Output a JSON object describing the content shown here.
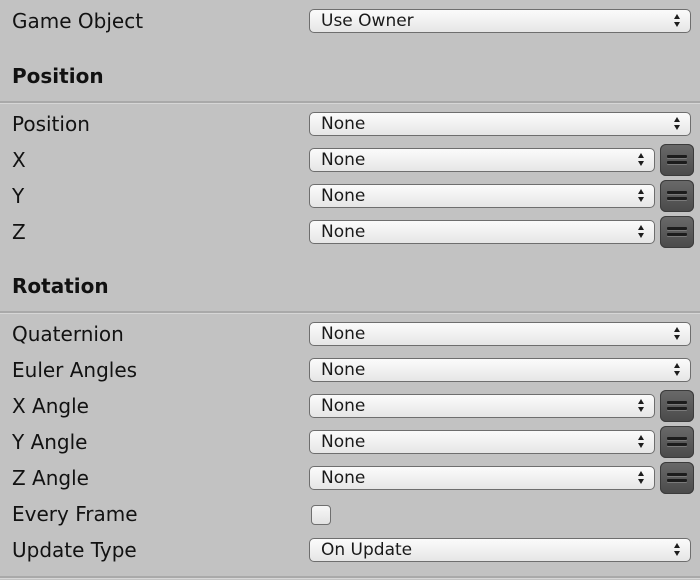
{
  "game_object": {
    "label": "Game Object",
    "value": "Use Owner"
  },
  "position_section": {
    "heading": "Position",
    "position": {
      "label": "Position",
      "value": "None"
    },
    "x": {
      "label": "X",
      "value": "None"
    },
    "y": {
      "label": "Y",
      "value": "None"
    },
    "z": {
      "label": "Z",
      "value": "None"
    }
  },
  "rotation_section": {
    "heading": "Rotation",
    "quaternion": {
      "label": "Quaternion",
      "value": "None"
    },
    "euler_angles": {
      "label": "Euler Angles",
      "value": "None"
    },
    "x_angle": {
      "label": "X Angle",
      "value": "None"
    },
    "y_angle": {
      "label": "Y Angle",
      "value": "None"
    },
    "z_angle": {
      "label": "Z Angle",
      "value": "None"
    }
  },
  "every_frame": {
    "label": "Every Frame",
    "checked": false
  },
  "update_type": {
    "label": "Update Type",
    "value": "On Update"
  },
  "icons": {
    "dropdown": "up-down-arrows-icon",
    "variable_toggle": "equals-icon"
  },
  "colors": {
    "background": "#c2c2c2",
    "separator": "#a9a9a9",
    "toggle_button": "#555555"
  }
}
